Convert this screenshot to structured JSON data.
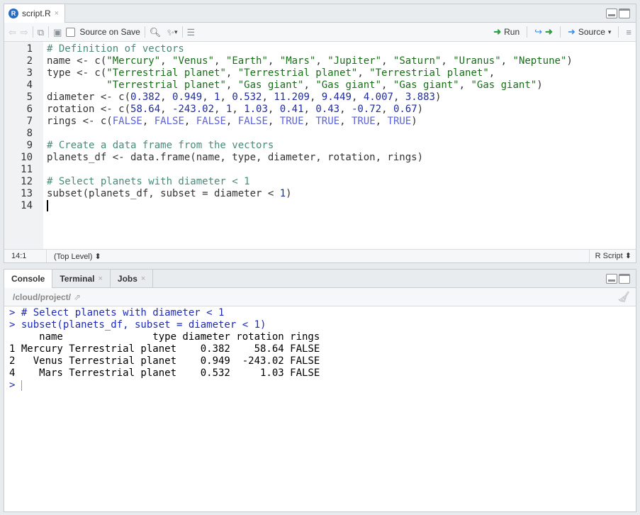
{
  "editor": {
    "tab_title": "script.R",
    "tab_close": "×",
    "file_icon": "R",
    "source_on_save_label": "Source on Save",
    "run_label": "Run",
    "source_label": "Source",
    "caret": "▾",
    "lines": [
      {
        "n": "1",
        "text": "# Definition of vectors"
      },
      {
        "n": "2",
        "text": "name <- c(\"Mercury\", \"Venus\", \"Earth\", \"Mars\", \"Jupiter\", \"Saturn\", \"Uranus\", \"Neptune\")"
      },
      {
        "n": "3",
        "text": "type <- c(\"Terrestrial planet\", \"Terrestrial planet\", \"Terrestrial planet\","
      },
      {
        "n": "4",
        "text": "          \"Terrestrial planet\", \"Gas giant\", \"Gas giant\", \"Gas giant\", \"Gas giant\")"
      },
      {
        "n": "5",
        "text": "diameter <- c(0.382, 0.949, 1, 0.532, 11.209, 9.449, 4.007, 3.883)"
      },
      {
        "n": "6",
        "text": "rotation <- c(58.64, -243.02, 1, 1.03, 0.41, 0.43, -0.72, 0.67)"
      },
      {
        "n": "7",
        "text": "rings <- c(FALSE, FALSE, FALSE, FALSE, TRUE, TRUE, TRUE, TRUE)"
      },
      {
        "n": "8",
        "text": ""
      },
      {
        "n": "9",
        "text": "# Create a data frame from the vectors"
      },
      {
        "n": "10",
        "text": "planets_df <- data.frame(name, type, diameter, rotation, rings)"
      },
      {
        "n": "11",
        "text": ""
      },
      {
        "n": "12",
        "text": "# Select planets with diameter < 1"
      },
      {
        "n": "13",
        "text": "subset(planets_df, subset = diameter < 1)"
      },
      {
        "n": "14",
        "text": ""
      }
    ],
    "status": {
      "position": "14:1",
      "scope": "(Top Level) ⬍",
      "filetype": "R Script ⬍"
    }
  },
  "console": {
    "tabs": [
      {
        "label": "Console",
        "closable": false
      },
      {
        "label": "Terminal",
        "closable": true
      },
      {
        "label": "Jobs",
        "closable": true
      }
    ],
    "tab_close": "×",
    "path": "/cloud/project/",
    "lines": [
      {
        "kind": "input",
        "text": "> # Select planets with diameter < 1"
      },
      {
        "kind": "input",
        "text": "> subset(planets_df, subset = diameter < 1)"
      },
      {
        "kind": "output",
        "text": "     name               type diameter rotation rings"
      },
      {
        "kind": "output",
        "text": "1 Mercury Terrestrial planet    0.382    58.64 FALSE"
      },
      {
        "kind": "output",
        "text": "2   Venus Terrestrial planet    0.949  -243.02 FALSE"
      },
      {
        "kind": "output",
        "text": "4    Mars Terrestrial planet    0.532     1.03 FALSE"
      }
    ],
    "prompt": ">"
  },
  "colors": {
    "comment": "#4a8a7a",
    "string": "#1a6d1a",
    "number": "#1f2b9e",
    "keyword": "#5b62e0",
    "prompt": "#1f2bb8",
    "run_green": "#2e9f3e",
    "source_blue": "#3a8ee6"
  }
}
